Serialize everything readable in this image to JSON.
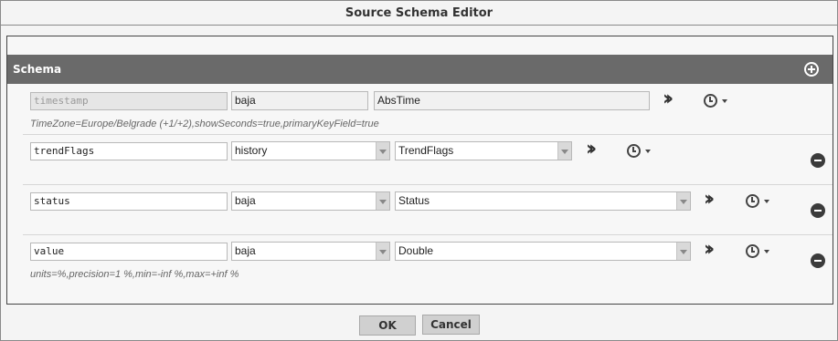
{
  "dialog": {
    "title": "Source Schema Editor"
  },
  "schema": {
    "header_label": "Schema"
  },
  "rows": [
    {
      "name": "timestamp",
      "module": "baja",
      "type": "AbsTime",
      "facets": "TimeZone=Europe/Belgrade (+1/+2),showSeconds=true,primaryKeyField=true"
    },
    {
      "name": "trendFlags",
      "module": "history",
      "type": "TrendFlags",
      "facets": ""
    },
    {
      "name": "status",
      "module": "baja",
      "type": "Status",
      "facets": ""
    },
    {
      "name": "value",
      "module": "baja",
      "type": "Double",
      "facets": "units=%,precision=1 %,min=-inf %,max=+inf %"
    }
  ],
  "footer": {
    "ok_label": "OK",
    "cancel_label": "Cancel"
  },
  "icons": {
    "add": "plus-circle-icon",
    "remove": "minus-circle-icon",
    "expand": "double-chevron-right-icon",
    "clock": "clock-icon",
    "caret": "caret-down-icon"
  },
  "colors": {
    "header_bg": "#6a6a6a",
    "button_bg": "#d0d0d0"
  }
}
